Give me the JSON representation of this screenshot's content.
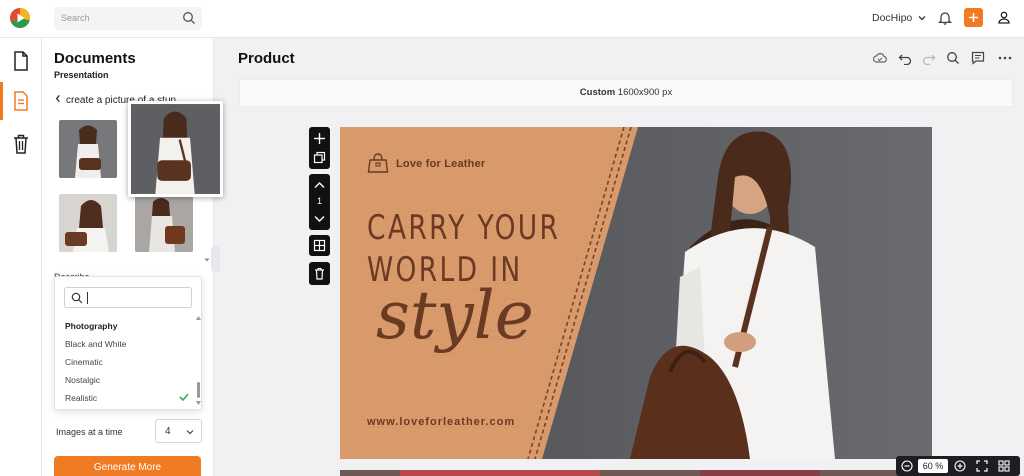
{
  "topbar": {
    "search_placeholder": "Search",
    "brand": "DocHipo"
  },
  "panel": {
    "title": "Documents",
    "subtitle": "Presentation",
    "prompt_back": "create a picture of a stun",
    "describe_label": "Describe",
    "dropdown": {
      "search_value": "",
      "items": [
        {
          "label": "Photography",
          "heading": true
        },
        {
          "label": "Black and White"
        },
        {
          "label": "Cinematic"
        },
        {
          "label": "Nostalgic"
        },
        {
          "label": "Realistic",
          "selected": true
        }
      ]
    },
    "images_label": "Images at a time",
    "images_value": "4",
    "generate_button": "Generate More"
  },
  "main": {
    "title": "Product",
    "size_label": "Custom",
    "size_value": "1600x900 px",
    "page_number": "1"
  },
  "canvas": {
    "brand": "Love for Leather",
    "headline_line1": "CARRY YOUR",
    "headline_line2": "WORLD IN",
    "script_word": "style",
    "url": "www.loveforleather.com"
  },
  "zoom": {
    "value": "60",
    "unit": "%"
  },
  "colors": {
    "accent": "#f07b22",
    "leather": "#d99a6c",
    "text_brown": "#6b3a22"
  }
}
